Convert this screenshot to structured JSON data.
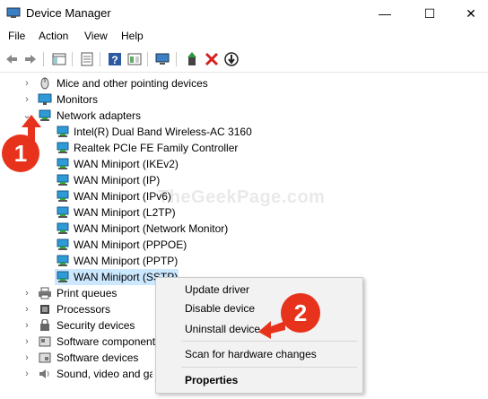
{
  "window": {
    "title": "Device Manager",
    "minimize": "—",
    "maximize": "☐",
    "close": "✕"
  },
  "menu": [
    "File",
    "Action",
    "View",
    "Help"
  ],
  "toolbar": {
    "icons": [
      "back-arrow-icon",
      "forward-arrow-icon",
      "show-hide-tree-icon",
      "properties-icon",
      "help-icon",
      "view-icon",
      "scan-hardware-icon",
      "update-driver-icon",
      "uninstall-icon",
      "disable-device-icon"
    ]
  },
  "tree": {
    "items": [
      {
        "label": "Mice and other pointing devices",
        "expander": "›"
      },
      {
        "label": "Monitors",
        "expander": "›"
      },
      {
        "label": "Network adapters",
        "expander": "⌄"
      },
      {
        "label": "Intel(R) Dual Band Wireless-AC 3160"
      },
      {
        "label": "Realtek PCIe FE Family Controller"
      },
      {
        "label": "WAN Miniport (IKEv2)"
      },
      {
        "label": "WAN Miniport (IP)"
      },
      {
        "label": "WAN Miniport (IPv6)"
      },
      {
        "label": "WAN Miniport (L2TP)"
      },
      {
        "label": "WAN Miniport (Network Monitor)"
      },
      {
        "label": "WAN Miniport (PPPOE)"
      },
      {
        "label": "WAN Miniport (PPTP)"
      },
      {
        "label": "WAN Miniport (SSTP)"
      },
      {
        "label": "Print queues",
        "expander": "›"
      },
      {
        "label": "Processors",
        "expander": "›"
      },
      {
        "label": "Security devices",
        "expander": "›"
      },
      {
        "label": "Software components",
        "expander": "›"
      },
      {
        "label": "Software devices",
        "expander": "›"
      },
      {
        "label": "Sound, video and game controllers",
        "expander": "›"
      }
    ]
  },
  "context_menu": {
    "items": [
      "Update driver",
      "Disable device",
      "Uninstall device",
      "Scan for hardware changes",
      "Properties"
    ]
  },
  "annotations": {
    "badge1": "1",
    "badge2": "2",
    "watermark": "TheGeekPage.com",
    "badge_color": "#e8331c"
  },
  "colors": {
    "selection": "#cce8ff",
    "net_icon": "#2e9ad6"
  }
}
